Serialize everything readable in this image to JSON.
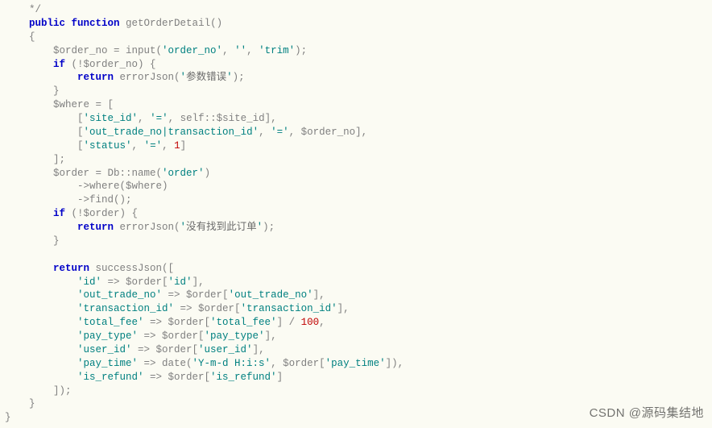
{
  "tokens": [
    {
      "txt": "    */\n",
      "cls": "op"
    },
    {
      "txt": "    ",
      "cls": ""
    },
    {
      "txt": "public function",
      "cls": "kw"
    },
    {
      "txt": " getOrderDetail()\n",
      "cls": ""
    },
    {
      "txt": "    {\n",
      "cls": ""
    },
    {
      "txt": "        $order_no = input(",
      "cls": ""
    },
    {
      "txt": "'order_no'",
      "cls": "str"
    },
    {
      "txt": ", ",
      "cls": ""
    },
    {
      "txt": "''",
      "cls": "str"
    },
    {
      "txt": ", ",
      "cls": ""
    },
    {
      "txt": "'trim'",
      "cls": "str"
    },
    {
      "txt": ");\n",
      "cls": ""
    },
    {
      "txt": "        ",
      "cls": ""
    },
    {
      "txt": "if",
      "cls": "kw"
    },
    {
      "txt": " (!$order_no) {\n",
      "cls": ""
    },
    {
      "txt": "            ",
      "cls": ""
    },
    {
      "txt": "return",
      "cls": "kw"
    },
    {
      "txt": " errorJson(",
      "cls": ""
    },
    {
      "txt": "'",
      "cls": "str"
    },
    {
      "txt": "参数错误",
      "cls": "chin"
    },
    {
      "txt": "'",
      "cls": "str"
    },
    {
      "txt": ");\n",
      "cls": ""
    },
    {
      "txt": "        }\n",
      "cls": ""
    },
    {
      "txt": "        $where = [\n",
      "cls": ""
    },
    {
      "txt": "            [",
      "cls": ""
    },
    {
      "txt": "'site_id'",
      "cls": "str"
    },
    {
      "txt": ", ",
      "cls": ""
    },
    {
      "txt": "'='",
      "cls": "str"
    },
    {
      "txt": ", self::$site_id],\n",
      "cls": ""
    },
    {
      "txt": "            [",
      "cls": ""
    },
    {
      "txt": "'out_trade_no|transaction_id'",
      "cls": "str"
    },
    {
      "txt": ", ",
      "cls": ""
    },
    {
      "txt": "'='",
      "cls": "str"
    },
    {
      "txt": ", $order_no],\n",
      "cls": ""
    },
    {
      "txt": "            [",
      "cls": ""
    },
    {
      "txt": "'status'",
      "cls": "str"
    },
    {
      "txt": ", ",
      "cls": ""
    },
    {
      "txt": "'='",
      "cls": "str"
    },
    {
      "txt": ", ",
      "cls": ""
    },
    {
      "txt": "1",
      "cls": "num"
    },
    {
      "txt": "]\n",
      "cls": ""
    },
    {
      "txt": "        ];\n",
      "cls": ""
    },
    {
      "txt": "        $order = Db::name(",
      "cls": ""
    },
    {
      "txt": "'order'",
      "cls": "str"
    },
    {
      "txt": ")\n",
      "cls": ""
    },
    {
      "txt": "            ->where($where)\n",
      "cls": ""
    },
    {
      "txt": "            ->find();\n",
      "cls": ""
    },
    {
      "txt": "        ",
      "cls": ""
    },
    {
      "txt": "if",
      "cls": "kw"
    },
    {
      "txt": " (!$order) {\n",
      "cls": ""
    },
    {
      "txt": "            ",
      "cls": ""
    },
    {
      "txt": "return",
      "cls": "kw"
    },
    {
      "txt": " errorJson(",
      "cls": ""
    },
    {
      "txt": "'",
      "cls": "str"
    },
    {
      "txt": "没有找到此订单",
      "cls": "chin"
    },
    {
      "txt": "'",
      "cls": "str"
    },
    {
      "txt": ");\n",
      "cls": ""
    },
    {
      "txt": "        }\n",
      "cls": ""
    },
    {
      "txt": "\n",
      "cls": ""
    },
    {
      "txt": "        ",
      "cls": ""
    },
    {
      "txt": "return",
      "cls": "kw"
    },
    {
      "txt": " successJson([\n",
      "cls": ""
    },
    {
      "txt": "            ",
      "cls": ""
    },
    {
      "txt": "'id'",
      "cls": "str"
    },
    {
      "txt": " => $order[",
      "cls": ""
    },
    {
      "txt": "'id'",
      "cls": "str"
    },
    {
      "txt": "],\n",
      "cls": ""
    },
    {
      "txt": "            ",
      "cls": ""
    },
    {
      "txt": "'out_trade_no'",
      "cls": "str"
    },
    {
      "txt": " => $order[",
      "cls": ""
    },
    {
      "txt": "'out_trade_no'",
      "cls": "str"
    },
    {
      "txt": "],\n",
      "cls": ""
    },
    {
      "txt": "            ",
      "cls": ""
    },
    {
      "txt": "'transaction_id'",
      "cls": "str"
    },
    {
      "txt": " => $order[",
      "cls": ""
    },
    {
      "txt": "'transaction_id'",
      "cls": "str"
    },
    {
      "txt": "],\n",
      "cls": ""
    },
    {
      "txt": "            ",
      "cls": ""
    },
    {
      "txt": "'total_fee'",
      "cls": "str"
    },
    {
      "txt": " => $order[",
      "cls": ""
    },
    {
      "txt": "'total_fee'",
      "cls": "str"
    },
    {
      "txt": "] / ",
      "cls": ""
    },
    {
      "txt": "100",
      "cls": "num"
    },
    {
      "txt": ",\n",
      "cls": ""
    },
    {
      "txt": "            ",
      "cls": ""
    },
    {
      "txt": "'pay_type'",
      "cls": "str"
    },
    {
      "txt": " => $order[",
      "cls": ""
    },
    {
      "txt": "'pay_type'",
      "cls": "str"
    },
    {
      "txt": "],\n",
      "cls": ""
    },
    {
      "txt": "            ",
      "cls": ""
    },
    {
      "txt": "'user_id'",
      "cls": "str"
    },
    {
      "txt": " => $order[",
      "cls": ""
    },
    {
      "txt": "'user_id'",
      "cls": "str"
    },
    {
      "txt": "],\n",
      "cls": ""
    },
    {
      "txt": "            ",
      "cls": ""
    },
    {
      "txt": "'pay_time'",
      "cls": "str"
    },
    {
      "txt": " => date(",
      "cls": ""
    },
    {
      "txt": "'Y-m-d H:i:s'",
      "cls": "str"
    },
    {
      "txt": ", $order[",
      "cls": ""
    },
    {
      "txt": "'pay_time'",
      "cls": "str"
    },
    {
      "txt": "]),\n",
      "cls": ""
    },
    {
      "txt": "            ",
      "cls": ""
    },
    {
      "txt": "'is_refund'",
      "cls": "str"
    },
    {
      "txt": " => $order[",
      "cls": ""
    },
    {
      "txt": "'is_refund'",
      "cls": "str"
    },
    {
      "txt": "]\n",
      "cls": ""
    },
    {
      "txt": "        ]);\n",
      "cls": ""
    },
    {
      "txt": "    }\n",
      "cls": ""
    },
    {
      "txt": "}\n",
      "cls": ""
    }
  ],
  "watermark": "CSDN @源码集结地"
}
